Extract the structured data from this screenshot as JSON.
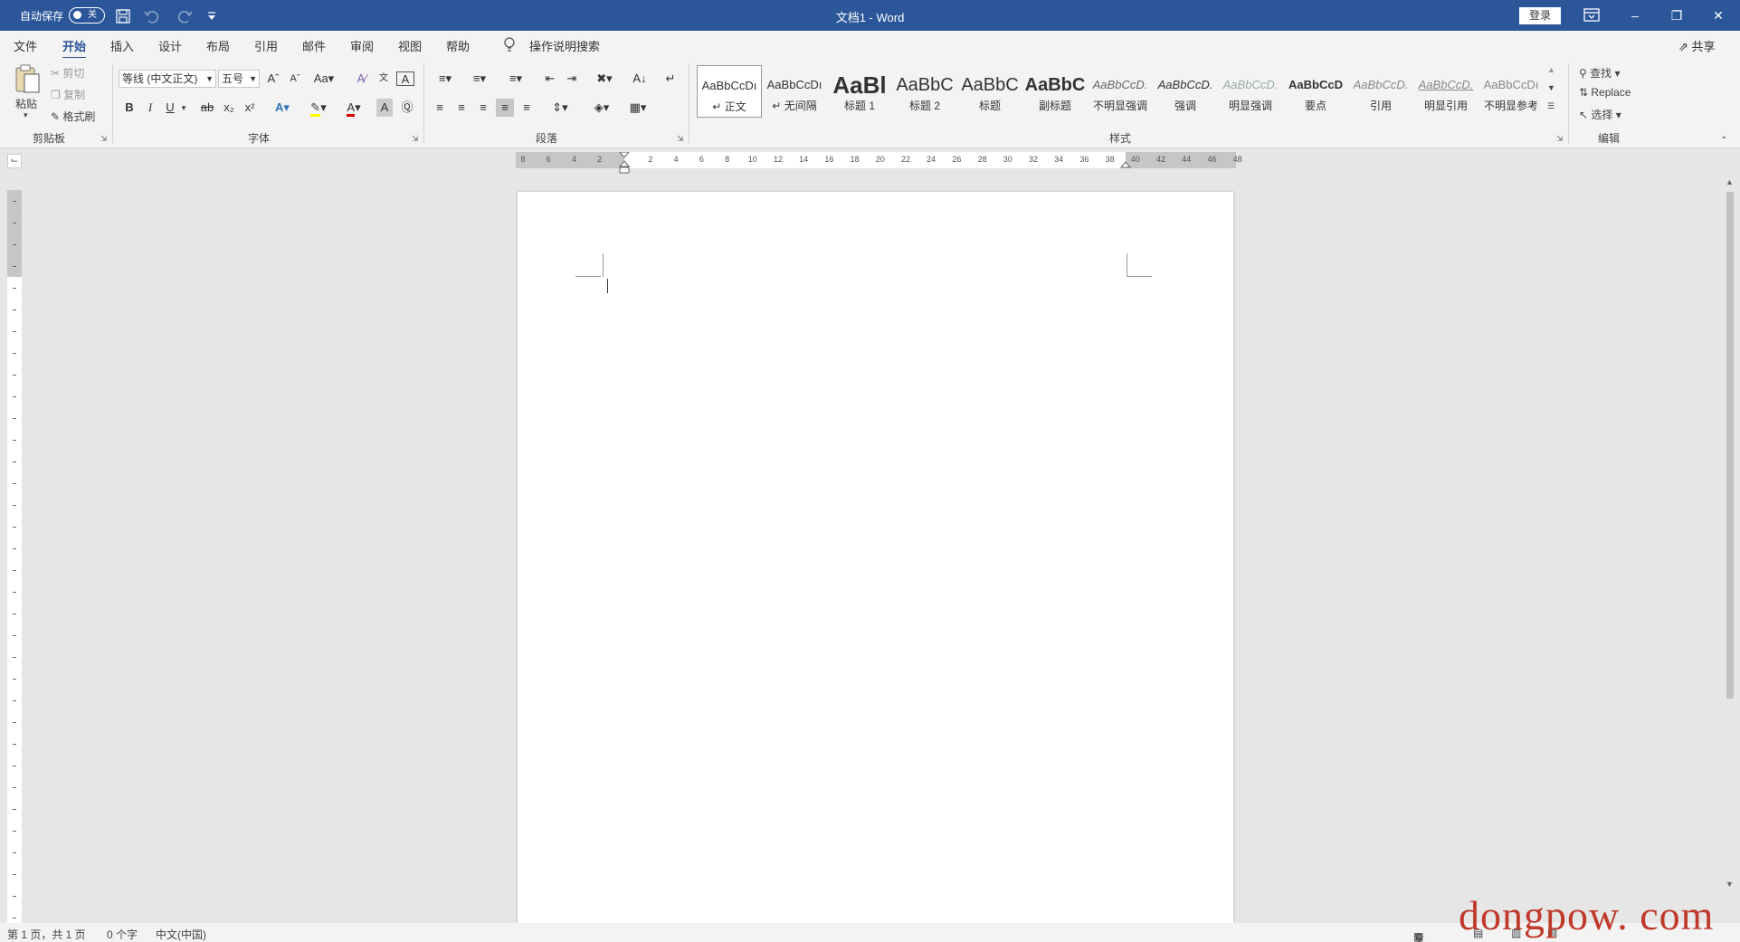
{
  "titlebar": {
    "autosave_label": "自动保存",
    "autosave_state": "关",
    "title": "文档1  -  Word",
    "login": "登录"
  },
  "tabs": [
    "文件",
    "开始",
    "插入",
    "设计",
    "布局",
    "引用",
    "邮件",
    "审阅",
    "视图",
    "帮助"
  ],
  "active_tab": "开始",
  "tell_me": "操作说明搜索",
  "share": "共享",
  "clipboard": {
    "paste": "粘贴",
    "cut": "剪切",
    "copy": "复制",
    "format_painter": "格式刷",
    "label": "剪贴板"
  },
  "font": {
    "family": "等线 (中文正文)",
    "size": "五号",
    "label": "字体",
    "bold": "B",
    "italic": "I",
    "underline": "U"
  },
  "paragraph": {
    "label": "段落"
  },
  "styles": {
    "label": "样式",
    "items": [
      {
        "preview": "AaBbCcDı",
        "name": "正文"
      },
      {
        "preview": "AaBbCcDı",
        "name": "无间隔"
      },
      {
        "preview": "AaBl",
        "name": "标题 1"
      },
      {
        "preview": "AaBbC",
        "name": "标题 2"
      },
      {
        "preview": "AaBbC",
        "name": "标题"
      },
      {
        "preview": "AaBbC",
        "name": "副标题"
      },
      {
        "preview": "AaBbCcD.",
        "name": "不明显强调"
      },
      {
        "preview": "AaBbCcD.",
        "name": "强调"
      },
      {
        "preview": "AaBbCcD.",
        "name": "明显强调"
      },
      {
        "preview": "AaBbCcD",
        "name": "要点"
      },
      {
        "preview": "AaBbCcD.",
        "name": "引用"
      },
      {
        "preview": "AaBbCcD.",
        "name": "明显引用"
      },
      {
        "preview": "AaBbCcDı",
        "name": "不明显参考"
      }
    ]
  },
  "editing": {
    "find": "查找",
    "replace": "Replace",
    "select": "选择",
    "label": "编辑"
  },
  "ruler": {
    "ticks": [
      "8",
      "6",
      "4",
      "2",
      "",
      "2",
      "4",
      "6",
      "8",
      "10",
      "12",
      "14",
      "16",
      "18",
      "20",
      "22",
      "24",
      "26",
      "28",
      "30",
      "32",
      "34",
      "36",
      "38",
      "40",
      "42",
      "44",
      "46",
      "48"
    ]
  },
  "status": {
    "page": "第 1 页，共 1 页",
    "words": "0 个字",
    "language": "中文(中国)",
    "focus": "专注"
  },
  "watermark": "dongpow. com"
}
